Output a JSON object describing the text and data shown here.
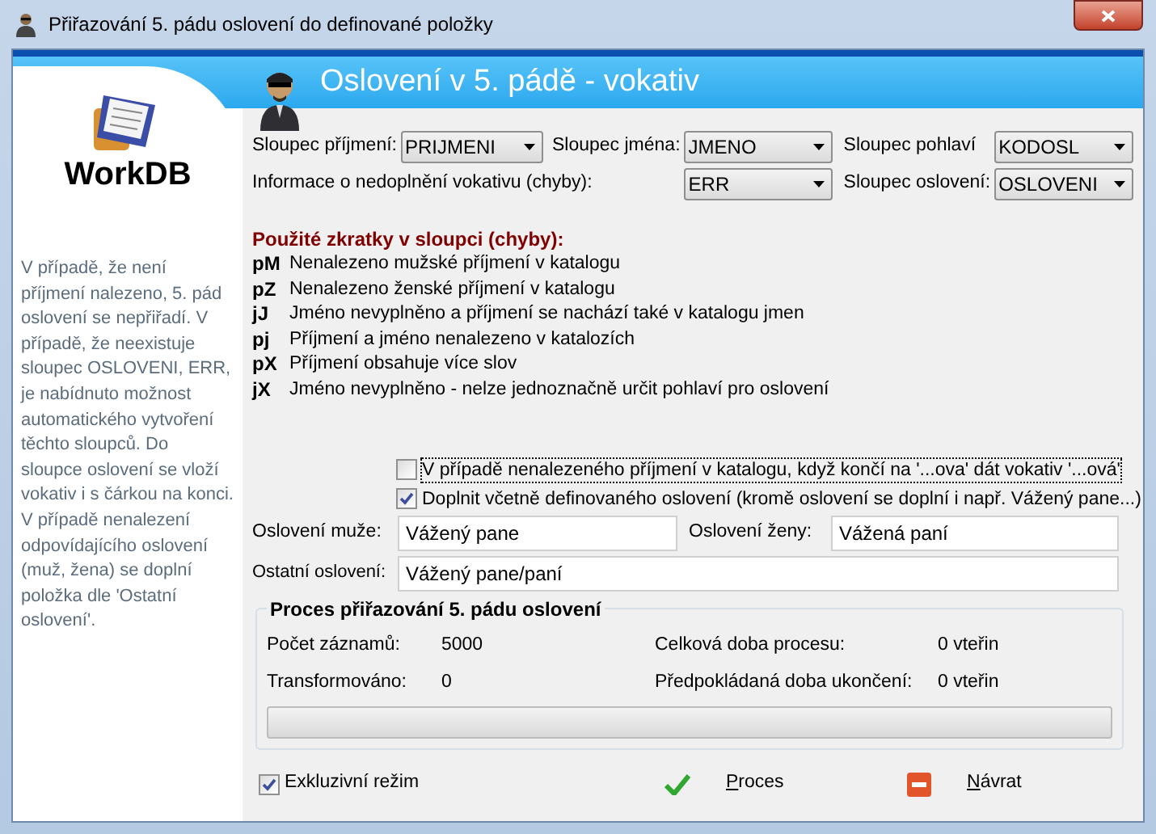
{
  "window": {
    "title": "Přiřazování 5. pádu oslovení do definované položky"
  },
  "header": {
    "title": "Oslovení v 5. pádě - vokativ"
  },
  "sidebar": {
    "logo": "WorkDB",
    "paragraphs": [
      "V případě, že není příjmení nalezeno, 5. pád oslovení se nepřiřadí. V případě, že neexistuje sloupec OSLOVENI, ERR, je nabídnuto možnost automatického vytvoření těchto sloupců. Do sloupce oslovení se vloží vokativ i s čárkou na konci.",
      "V případě nenalezení odpovídajícího oslovení (muž, žena) se doplní položka dle 'Ostatní oslovení'."
    ]
  },
  "selects": [
    {
      "label": "Sloupec příjmení:",
      "value": "PRIJMENI"
    },
    {
      "label": "Sloupec jména:",
      "value": "JMENO"
    },
    {
      "label": "Sloupec pohlaví",
      "value": "KODOSL"
    },
    {
      "label": "Informace o nedoplnění vokativu (chyby):",
      "value": "ERR"
    },
    {
      "label": "Sloupec oslovení:",
      "value": "OSLOVENI"
    }
  ],
  "abbreviations": {
    "title": "Použité zkratky v sloupci (chyby):",
    "items": [
      {
        "code": "pM",
        "text": "Nenalezeno mužské příjmení v katalogu"
      },
      {
        "code": "pZ",
        "text": "Nenalezeno ženské příjmení v katalogu"
      },
      {
        "code": "jJ",
        "text": "Jméno nevyplněno a příjmení se nachází také v katalogu jmen"
      },
      {
        "code": "pj",
        "text": "Příjmení a jméno nenalezeno v katalozích"
      },
      {
        "code": "pX",
        "text": "Příjmení obsahuje více slov"
      },
      {
        "code": "jX",
        "text": "Jméno nevyplněno - nelze jednoznačně určit pohlaví pro oslovení"
      }
    ]
  },
  "options": [
    {
      "label": "V případě nenalezeného příjmení v katalogu, když končí na '...ova' dát vokativ '...ová'",
      "checked": false,
      "focused": true
    },
    {
      "label": "Doplnit včetně definovaného oslovení (kromě oslovení se doplní i např. Vážený pane...)",
      "checked": true,
      "focused": false
    }
  ],
  "salutations": [
    {
      "label": "Oslovení muže:",
      "value": "Vážený pane"
    },
    {
      "label": "Oslovení ženy:",
      "value": "Vážená paní"
    },
    {
      "label": "Ostatní oslovení:",
      "value": "Vážený pane/paní"
    }
  ],
  "process": {
    "title": "Proces přiřazování 5. pádu oslovení",
    "stats": [
      {
        "label": "Počet záznamů:",
        "value": "5000"
      },
      {
        "label": "Celková doba procesu:",
        "value": "0 vteřin"
      },
      {
        "label": "Transformováno:",
        "value": "0"
      },
      {
        "label": "Předpokládaná doba ukončení:",
        "value": "0 vteřin"
      }
    ],
    "progress": {
      "level": 0
    }
  },
  "exclusive": {
    "label": "Exkluzivní režim",
    "checked": true
  },
  "buttons": [
    {
      "label": "Proces",
      "kind": "ok"
    },
    {
      "label": "Návrat",
      "kind": "back"
    }
  ]
}
